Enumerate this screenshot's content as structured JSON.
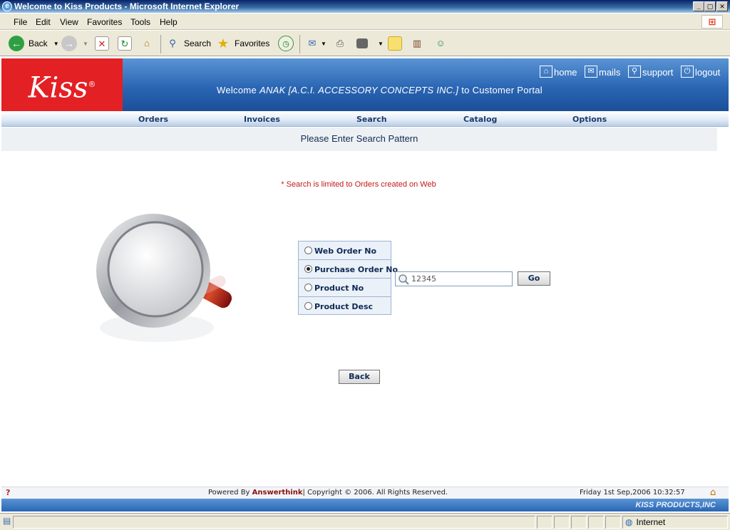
{
  "window": {
    "title": "Welcome to Kiss Products - Microsoft Internet Explorer"
  },
  "menu": [
    "File",
    "Edit",
    "View",
    "Favorites",
    "Tools",
    "Help"
  ],
  "toolbar": {
    "back": "Back",
    "search": "Search",
    "favorites": "Favorites"
  },
  "header": {
    "logo": "Kiss",
    "links": {
      "home": "home",
      "mails": "mails",
      "support": "support",
      "logout": "logout"
    },
    "welcome_prefix": "Welcome ",
    "welcome_user": "ANAK [A.C.I. ACCESSORY CONCEPTS INC.]",
    "welcome_suffix": " to Customer Portal"
  },
  "nav": {
    "orders": "Orders",
    "invoices": "Invoices",
    "search": "Search",
    "catalog": "Catalog",
    "options": "Options"
  },
  "page": {
    "heading": "Please Enter Search Pattern",
    "note": "* Search is limited to Orders created on Web",
    "options": [
      {
        "label": "Web Order No",
        "selected": false
      },
      {
        "label": "Purchase Order No",
        "selected": true
      },
      {
        "label": "Product No",
        "selected": false
      },
      {
        "label": "Product Desc",
        "selected": false
      }
    ],
    "search_value": "12345",
    "go_label": "Go",
    "back_label": "Back"
  },
  "footer": {
    "powered_prefix": "Powered By ",
    "powered_brand": "Answerthink",
    "copyright": "| Copyright © 2006. All Rights Reserved.",
    "datetime": "Friday 1st Sep,2006 10:32:57",
    "brand": "KISS PRODUCTS,INC"
  },
  "status": {
    "zone": "Internet"
  },
  "colors": {
    "brand_red": "#e32024",
    "banner_blue": "#2a66b4",
    "note_red": "#c41818"
  }
}
